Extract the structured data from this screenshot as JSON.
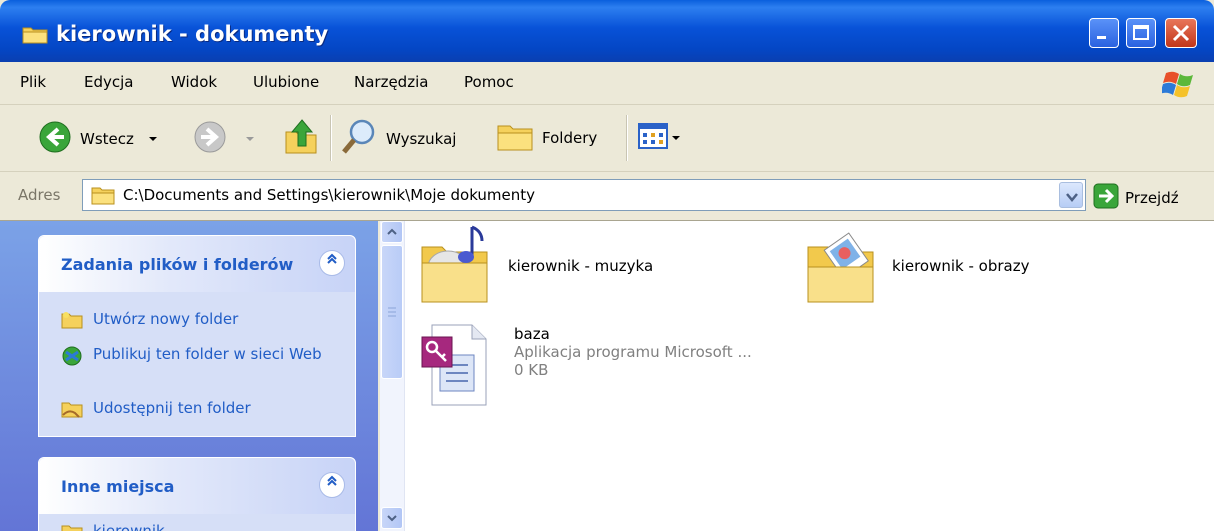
{
  "window": {
    "title": "kierownik - dokumenty"
  },
  "menu": [
    "Plik",
    "Edycja",
    "Widok",
    "Ulubione",
    "Narzędzia",
    "Pomoc"
  ],
  "toolbar": {
    "back_label": "Wstecz",
    "search_label": "Wyszukaj",
    "folders_label": "Foldery"
  },
  "address": {
    "label": "Adres",
    "path": "C:\\Documents and Settings\\kierownik\\Moje dokumenty",
    "go_label": "Przejdź"
  },
  "left_panel": {
    "file_tasks": {
      "title": "Zadania plików i folderów",
      "items": [
        "Utwórz nowy folder",
        "Publikuj ten folder w sieci Web",
        "Udostępnij ten folder"
      ]
    },
    "other_places": {
      "title": "Inne miejsca",
      "items": [
        "kierownik"
      ]
    }
  },
  "files": [
    {
      "name": "kierownik - muzyka",
      "icon": "music-folder-icon"
    },
    {
      "name": "kierownik - obrazy",
      "icon": "pictures-folder-icon"
    },
    {
      "name": "baza",
      "type": "Aplikacja programu Microsoft ...",
      "size": "0 KB",
      "icon": "access-database-icon"
    }
  ],
  "colors": {
    "titlebar": "#0852d8",
    "link": "#215dc6",
    "panel": "#6375d6"
  }
}
